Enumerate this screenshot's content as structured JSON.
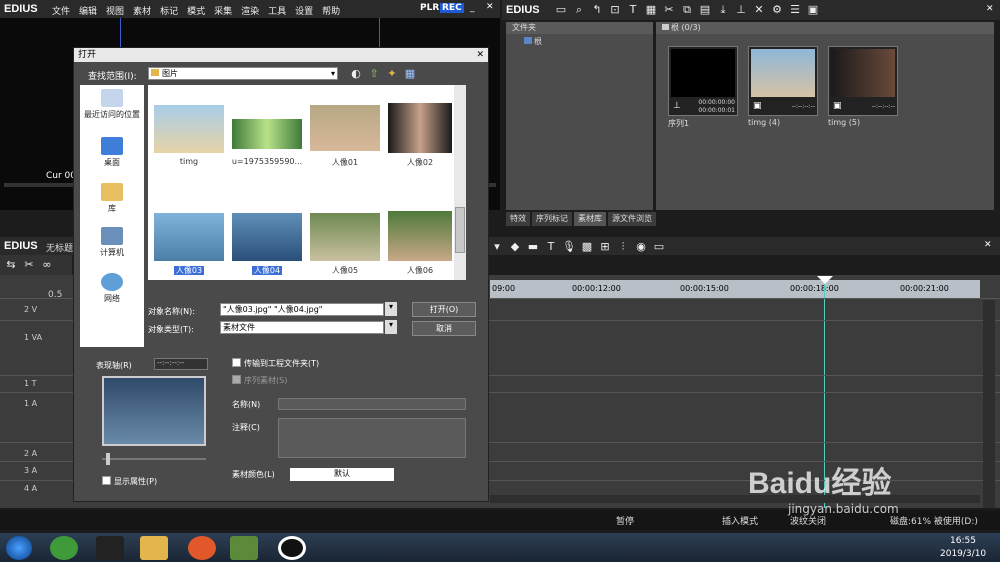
{
  "brand": "EDIUS",
  "menu": [
    "文件",
    "编辑",
    "视图",
    "素材",
    "标记",
    "模式",
    "采集",
    "渲染",
    "工具",
    "设置",
    "帮助"
  ],
  "plr": "PLR",
  "rec": "REC",
  "preview": {
    "cur_label": "Cur 00"
  },
  "bin": {
    "folder_header": "文件夹",
    "root": "根",
    "path_header": "根 (0/3)",
    "items": [
      {
        "label": "序列1",
        "tc1": "00:00:00:00",
        "tc2": "00:00:00:01"
      },
      {
        "label": "timg (4)",
        "tc1": "--:--:--:--"
      },
      {
        "label": "timg (5)",
        "tc1": "--:--:--:--"
      }
    ],
    "tabs": [
      "特效",
      "序列标记",
      "素材库",
      "源文件浏览"
    ]
  },
  "dialog": {
    "title": "打开",
    "lookin_label": "查找范围(I):",
    "lookin_value": "图片",
    "places": [
      "最近访问的位置",
      "桌面",
      "库",
      "计算机",
      "网络"
    ],
    "files": [
      "timg",
      "u=1975359590...",
      "人像01",
      "人像02",
      "人像03",
      "人像04",
      "人像05",
      "人像06"
    ],
    "filename_label": "对象名称(N):",
    "filename_value": "\"人像03.jpg\" \"人像04.jpg\"",
    "filetype_label": "对象类型(T):",
    "filetype_value": "素材文件",
    "open_btn": "打开(O)",
    "cancel_btn": "取消",
    "duration_label": "表现轴(R)",
    "duration_value": "--:--:--:--",
    "transfer": "传输到工程文件夹(T)",
    "sequence": "序列素材(S)",
    "name_label": "名称(N)",
    "comment_label": "注释(C)",
    "color_label": "素材颜色(L)",
    "color_value": "默认",
    "show_props": "显示属性(P)"
  },
  "timeline": {
    "title_prefix": "无标题",
    "ruler": [
      "09:00",
      "00:00:12:00",
      "00:00:15:00",
      "00:00:18:00",
      "00:00:21:00"
    ],
    "tracks": [
      "2 V",
      "1 VA",
      "1 T",
      "1 A",
      "2 A",
      "3 A",
      "4 A"
    ],
    "zoom": "0.5"
  },
  "status": {
    "pause": "暂停",
    "insert": "插入模式",
    "ripple": "波纹关闭",
    "disk": "磁盘:61% 被使用(D:)"
  },
  "tray": {
    "time": "16:55",
    "date": "2019/3/10"
  },
  "watermark": {
    "line1": "Baidu经验",
    "line2": "jingyan.baidu.com"
  }
}
